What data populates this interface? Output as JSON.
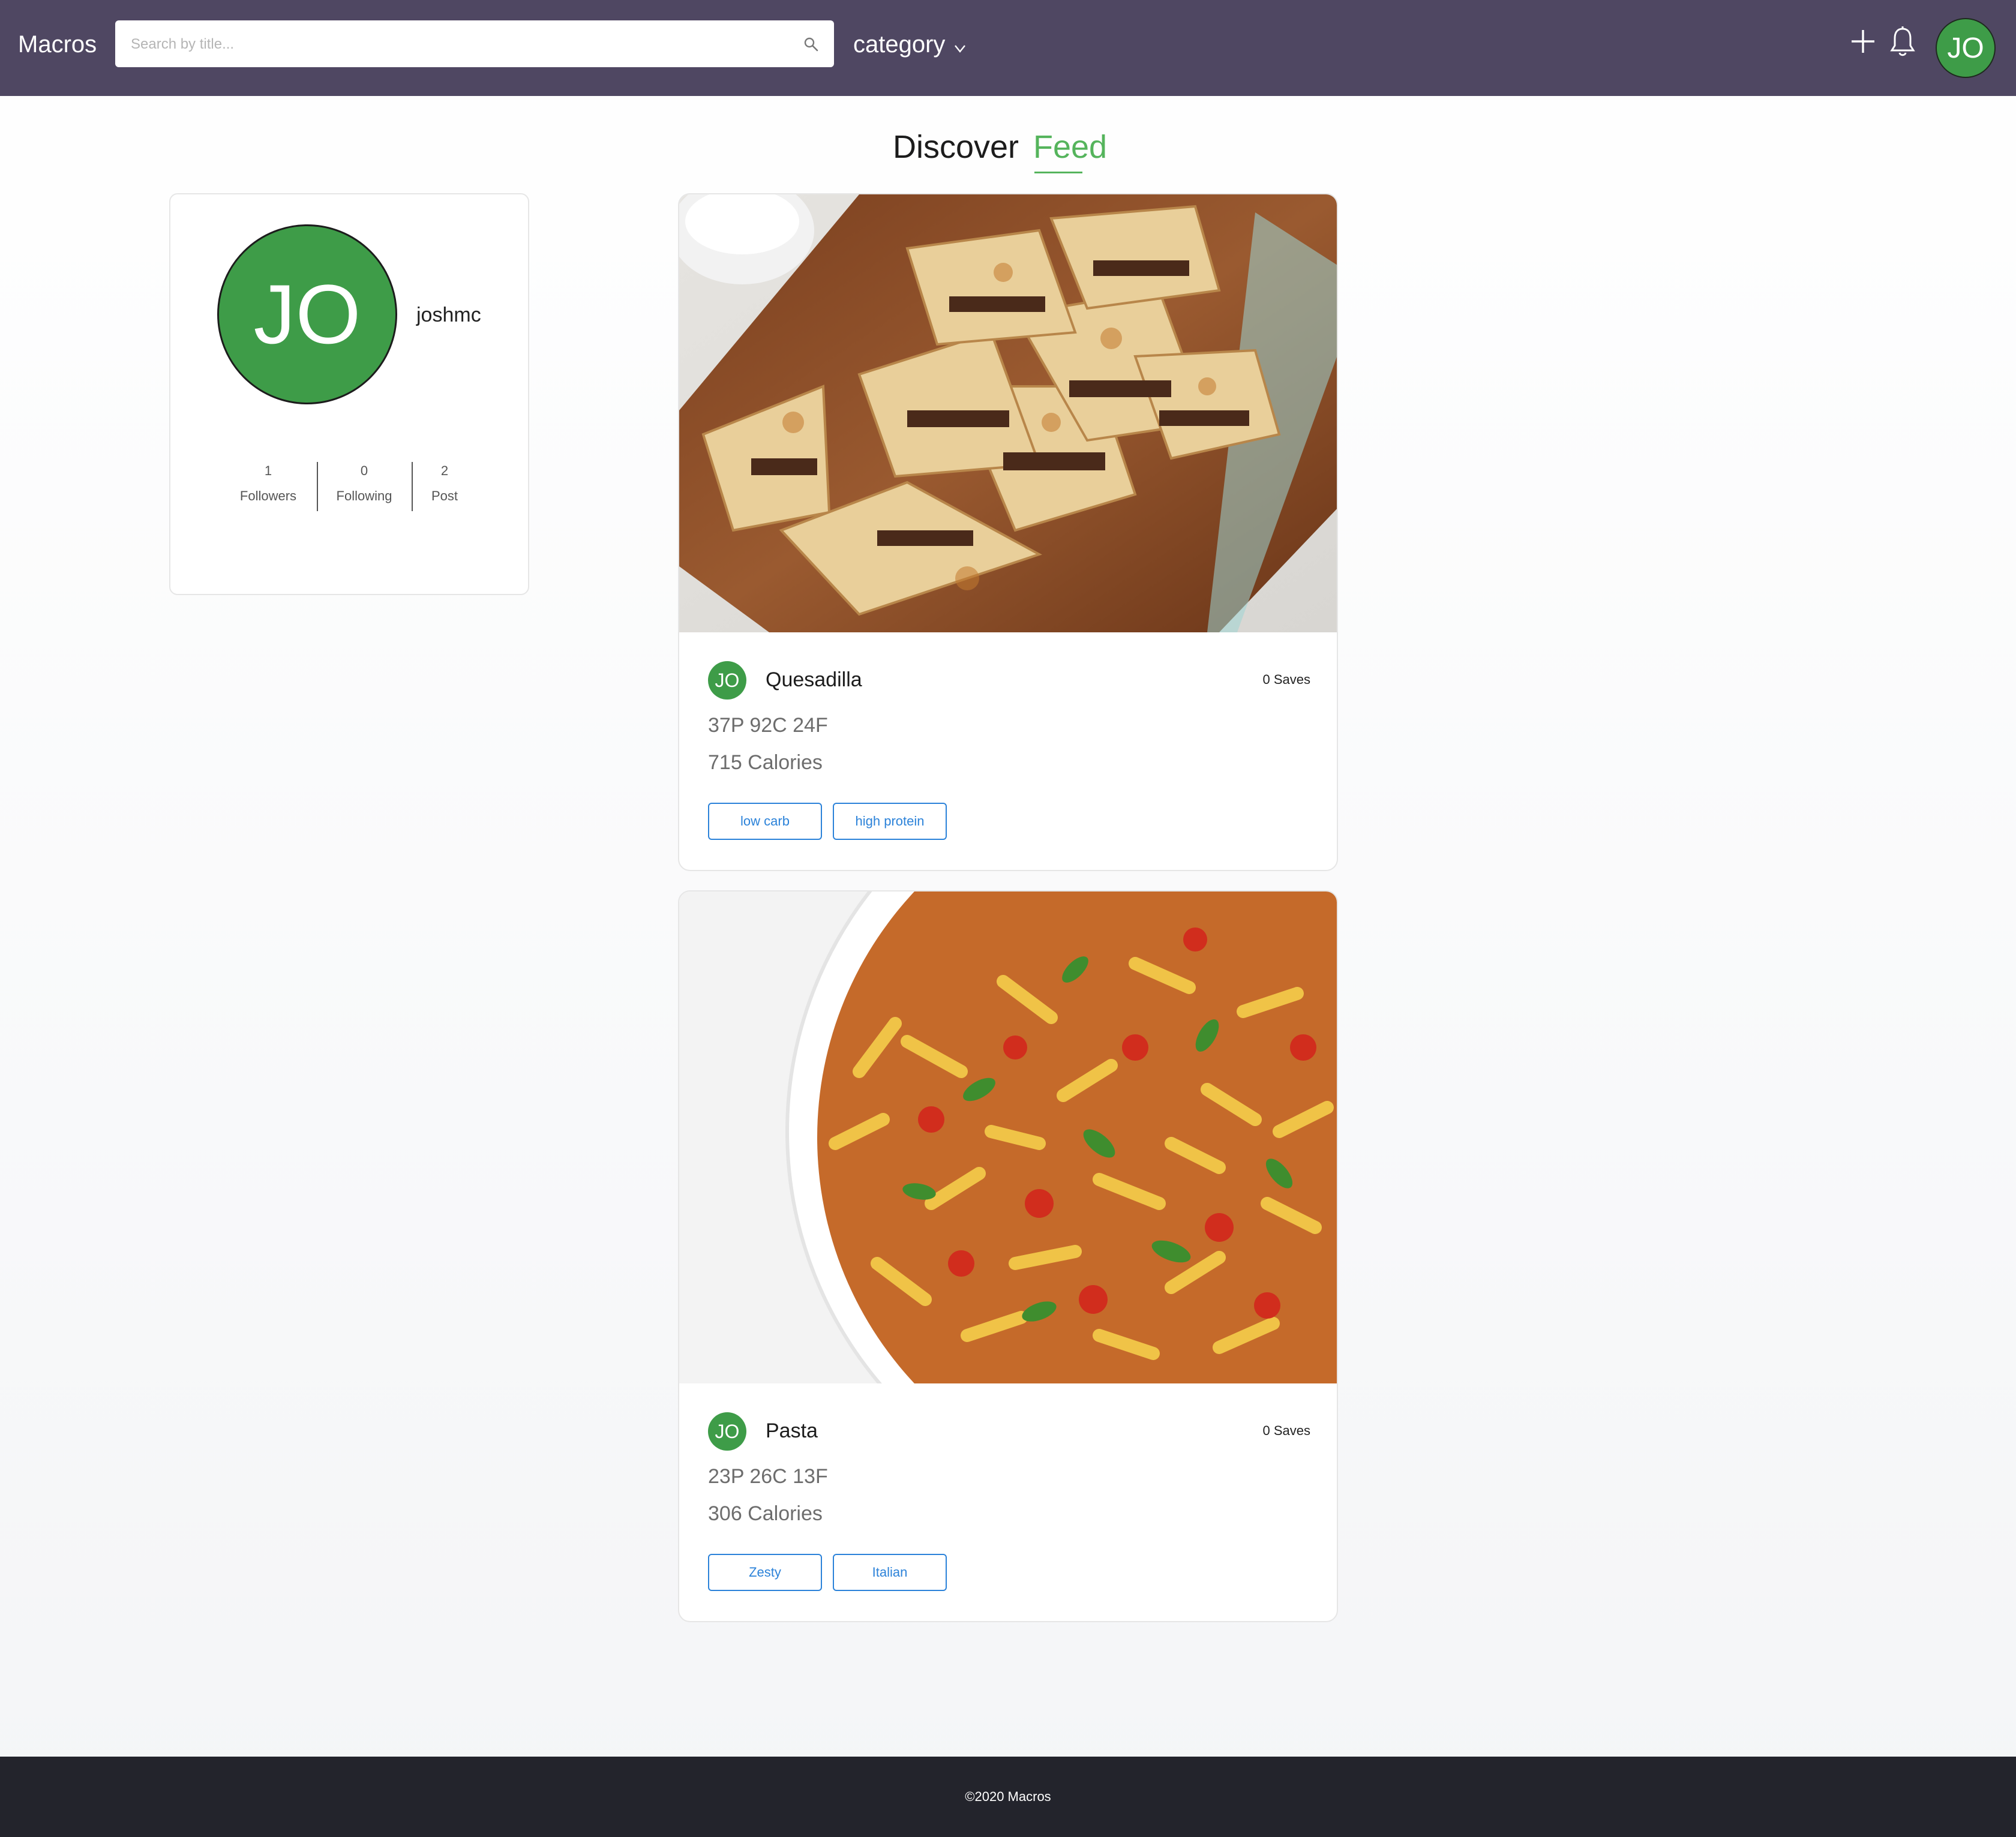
{
  "header": {
    "brand": "Macros",
    "search_placeholder": "Search by title...",
    "category_label": "category",
    "avatar_initials": "JO"
  },
  "tabs": [
    {
      "label": "Discover",
      "active": false
    },
    {
      "label": "Feed",
      "active": true
    }
  ],
  "profile": {
    "initials": "JO",
    "username": "joshmc",
    "stats": [
      {
        "value": "1",
        "label": "Followers"
      },
      {
        "value": "0",
        "label": "Following"
      },
      {
        "value": "2",
        "label": "Post"
      }
    ]
  },
  "recipes": [
    {
      "author_initials": "JO",
      "title": "Quesadilla",
      "saves": "0 Saves",
      "macros": "37P 92C 24F",
      "calories": "715 Calories",
      "tags": [
        "low carb",
        "high protein"
      ]
    },
    {
      "author_initials": "JO",
      "title": "Pasta",
      "saves": "0 Saves",
      "macros": "23P 26C 13F",
      "calories": "306 Calories",
      "tags": [
        "Zesty",
        "Italian"
      ]
    }
  ],
  "footer": {
    "text": "©2020 Macros"
  },
  "colors": {
    "header_bg": "#4f4762",
    "accent_green": "#3e9c48",
    "feed_green": "#55b45c",
    "tag_blue": "#2b82d9",
    "footer_bg": "#23242c"
  }
}
